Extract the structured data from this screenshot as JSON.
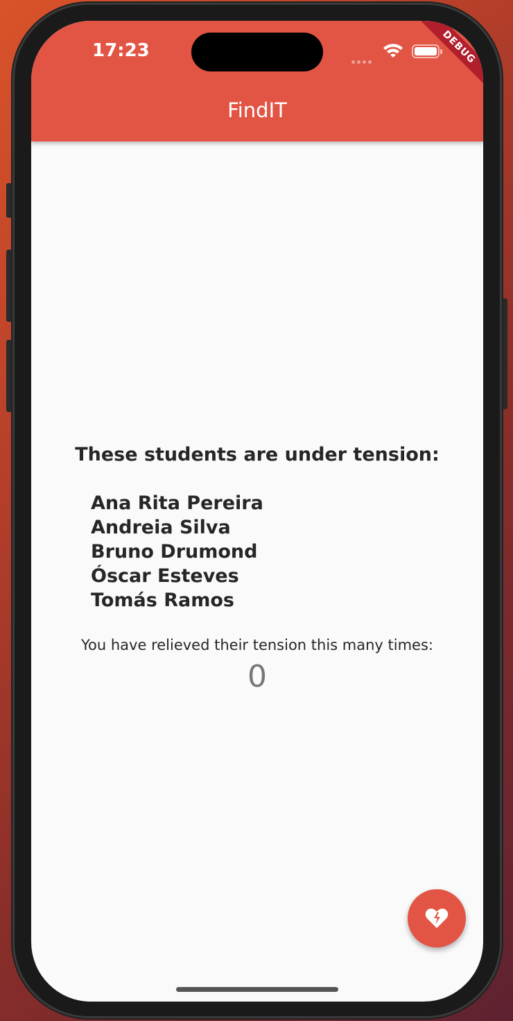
{
  "status_bar": {
    "time": "17:23",
    "debug_label": "DEBUG"
  },
  "app_bar": {
    "title": "FindIT",
    "color": "#e25544"
  },
  "main": {
    "heading": "These students are under tension:",
    "students": [
      "Ana Rita Pereira",
      "Andreia Silva",
      "Bruno Drumond",
      "Óscar Esteves",
      "Tomás Ramos"
    ],
    "counter_label": "You have relieved their tension this many times:",
    "counter_value": "0"
  },
  "fab": {
    "icon": "broken-heart-icon",
    "color": "#e25544"
  }
}
